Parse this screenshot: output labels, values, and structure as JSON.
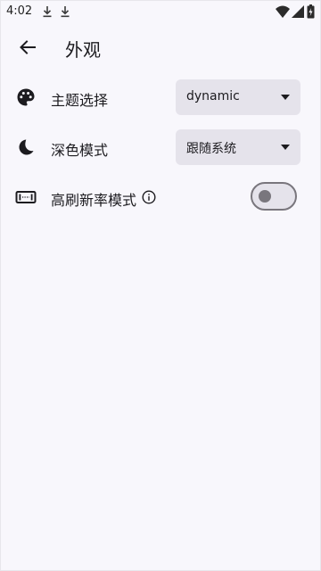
{
  "status_bar": {
    "time": "4:02",
    "icons": [
      "download-icon",
      "download-icon",
      "wifi-icon",
      "signal-icon",
      "battery-icon"
    ]
  },
  "header": {
    "back_icon": "arrow-back-icon",
    "title": "外观"
  },
  "settings": {
    "theme": {
      "icon": "palette-icon",
      "label": "主题选择",
      "value": "dynamic"
    },
    "dark_mode": {
      "icon": "moon-icon",
      "label": "深色模式",
      "value": "跟随系统"
    },
    "high_refresh": {
      "icon": "screen-icon",
      "label": "高刷新率模式",
      "info_icon": "info-icon",
      "enabled": false
    }
  },
  "colors": {
    "background": "#f8f7fc",
    "surface_variant": "#e5e3eb",
    "on_surface": "#1c1b1f",
    "outline": "#79767d"
  }
}
